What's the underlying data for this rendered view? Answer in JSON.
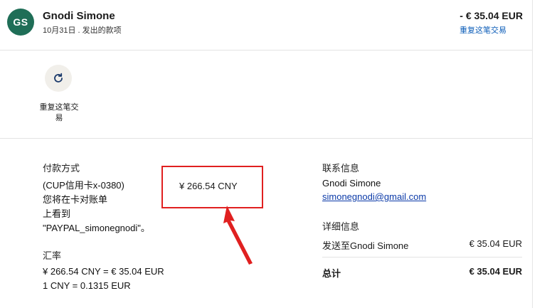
{
  "header": {
    "avatar_initials": "GS",
    "name": "Gnodi Simone",
    "subtitle": "10月31日 . 发出的款项",
    "amount": "- € 35.04 EUR",
    "repeat_link": "重复这笔交易"
  },
  "action": {
    "icon": "refresh-icon",
    "label": "重复这笔交易"
  },
  "payment": {
    "heading": "付款方式",
    "method_line1": "(CUP信用卡x-0380)",
    "method_line2": "您将在卡对账单",
    "method_line3": "上看到",
    "method_line4": "\"PAYPAL_simonegnodi\"。",
    "amount_cny": "¥ 266.54 CNY",
    "highlight_color": "#e02020"
  },
  "exchange": {
    "heading": "汇率",
    "line1": "¥ 266.54 CNY = € 35.04 EUR",
    "line2": "1 CNY = 0.1315 EUR"
  },
  "contact": {
    "heading": "联系信息",
    "name": "Gnodi Simone",
    "email": "simonegnodi@gmail.com"
  },
  "details": {
    "heading": "详细信息",
    "sent_label": "发送至Gnodi Simone",
    "sent_value": "€ 35.04 EUR",
    "total_label": "总计",
    "total_value": "€ 35.04 EUR"
  },
  "colors": {
    "avatar_bg": "#1f6e57",
    "link": "#0b5cb8"
  }
}
